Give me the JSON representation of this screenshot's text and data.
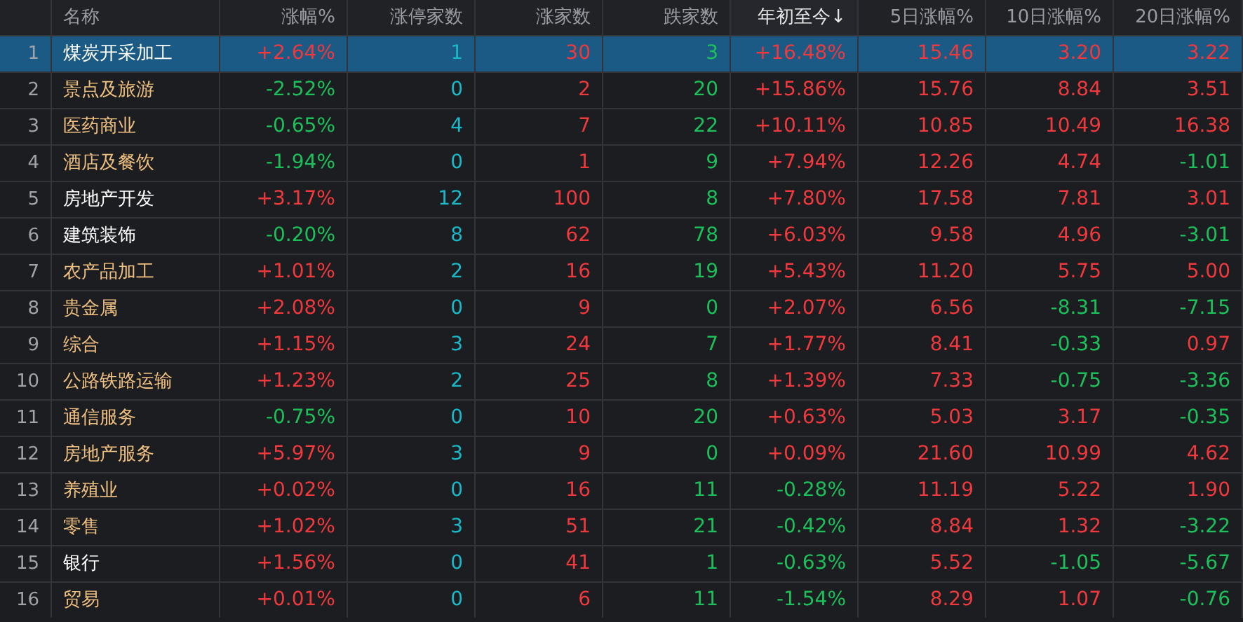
{
  "table": {
    "columns": [
      {
        "label": "名称",
        "sorted": false
      },
      {
        "label": "涨幅%",
        "sorted": false
      },
      {
        "label": "涨停家数",
        "sorted": false,
        "color": "#19b8c8"
      },
      {
        "label": "涨家数",
        "sorted": false,
        "color": "#f0393c"
      },
      {
        "label": "跌家数",
        "sorted": false,
        "color": "#1cc05a"
      },
      {
        "label": "年初至今↓",
        "sorted": true
      },
      {
        "label": "5日涨幅%",
        "sorted": false
      },
      {
        "label": "10日涨幅%",
        "sorted": false
      },
      {
        "label": "20日涨幅%",
        "sorted": false
      }
    ],
    "rows": [
      {
        "num": "1",
        "selected": true,
        "cells": [
          {
            "t": "煤炭开采加工",
            "color": "#ffffff"
          },
          {
            "t": "+2.64%",
            "up": true
          },
          {
            "t": "1"
          },
          {
            "t": "30"
          },
          {
            "t": "3"
          },
          {
            "t": "+16.48%",
            "up": true
          },
          {
            "t": "15.46",
            "up": true
          },
          {
            "t": "3.20",
            "up": true
          },
          {
            "t": "3.22",
            "up": true
          }
        ]
      },
      {
        "num": "2",
        "selected": false,
        "cells": [
          {
            "t": "景点及旅游",
            "color": "#f0c080"
          },
          {
            "t": "-2.52%",
            "up": false
          },
          {
            "t": "0"
          },
          {
            "t": "2"
          },
          {
            "t": "20"
          },
          {
            "t": "+15.86%",
            "up": true
          },
          {
            "t": "15.76",
            "up": true
          },
          {
            "t": "8.84",
            "up": true
          },
          {
            "t": "3.51",
            "up": true
          }
        ]
      },
      {
        "num": "3",
        "selected": false,
        "cells": [
          {
            "t": "医药商业",
            "color": "#f0c080"
          },
          {
            "t": "-0.65%",
            "up": false
          },
          {
            "t": "4"
          },
          {
            "t": "7"
          },
          {
            "t": "22"
          },
          {
            "t": "+10.11%",
            "up": true
          },
          {
            "t": "10.85",
            "up": true
          },
          {
            "t": "10.49",
            "up": true
          },
          {
            "t": "16.38",
            "up": true
          }
        ]
      },
      {
        "num": "4",
        "selected": false,
        "cells": [
          {
            "t": "酒店及餐饮",
            "color": "#f0c080"
          },
          {
            "t": "-1.94%",
            "up": false
          },
          {
            "t": "0"
          },
          {
            "t": "1"
          },
          {
            "t": "9"
          },
          {
            "t": "+7.94%",
            "up": true
          },
          {
            "t": "12.26",
            "up": true
          },
          {
            "t": "4.74",
            "up": true
          },
          {
            "t": "-1.01",
            "up": false
          }
        ]
      },
      {
        "num": "5",
        "selected": false,
        "cells": [
          {
            "t": "房地产开发",
            "color": "#ffffff"
          },
          {
            "t": "+3.17%",
            "up": true
          },
          {
            "t": "12"
          },
          {
            "t": "100"
          },
          {
            "t": "8"
          },
          {
            "t": "+7.80%",
            "up": true
          },
          {
            "t": "17.58",
            "up": true
          },
          {
            "t": "7.81",
            "up": true
          },
          {
            "t": "3.01",
            "up": true
          }
        ]
      },
      {
        "num": "6",
        "selected": false,
        "cells": [
          {
            "t": "建筑装饰",
            "color": "#ffffff"
          },
          {
            "t": "-0.20%",
            "up": false
          },
          {
            "t": "8"
          },
          {
            "t": "62"
          },
          {
            "t": "78"
          },
          {
            "t": "+6.03%",
            "up": true
          },
          {
            "t": "9.58",
            "up": true
          },
          {
            "t": "4.96",
            "up": true
          },
          {
            "t": "-3.01",
            "up": false
          }
        ]
      },
      {
        "num": "7",
        "selected": false,
        "cells": [
          {
            "t": "农产品加工",
            "color": "#f0c080"
          },
          {
            "t": "+1.01%",
            "up": true
          },
          {
            "t": "2"
          },
          {
            "t": "16"
          },
          {
            "t": "19"
          },
          {
            "t": "+5.43%",
            "up": true
          },
          {
            "t": "11.20",
            "up": true
          },
          {
            "t": "5.75",
            "up": true
          },
          {
            "t": "5.00",
            "up": true
          }
        ]
      },
      {
        "num": "8",
        "selected": false,
        "cells": [
          {
            "t": "贵金属",
            "color": "#f0c080"
          },
          {
            "t": "+2.08%",
            "up": true
          },
          {
            "t": "0"
          },
          {
            "t": "9"
          },
          {
            "t": "0"
          },
          {
            "t": "+2.07%",
            "up": true
          },
          {
            "t": "6.56",
            "up": true
          },
          {
            "t": "-8.31",
            "up": false
          },
          {
            "t": "-7.15",
            "up": false
          }
        ]
      },
      {
        "num": "9",
        "selected": false,
        "cells": [
          {
            "t": "综合",
            "color": "#f0c080"
          },
          {
            "t": "+1.15%",
            "up": true
          },
          {
            "t": "3"
          },
          {
            "t": "24"
          },
          {
            "t": "7"
          },
          {
            "t": "+1.77%",
            "up": true
          },
          {
            "t": "8.41",
            "up": true
          },
          {
            "t": "-0.33",
            "up": false
          },
          {
            "t": "0.97",
            "up": true
          }
        ]
      },
      {
        "num": "10",
        "selected": false,
        "cells": [
          {
            "t": "公路铁路运输",
            "color": "#f0c080"
          },
          {
            "t": "+1.23%",
            "up": true
          },
          {
            "t": "2"
          },
          {
            "t": "25"
          },
          {
            "t": "8"
          },
          {
            "t": "+1.39%",
            "up": true
          },
          {
            "t": "7.33",
            "up": true
          },
          {
            "t": "-0.75",
            "up": false
          },
          {
            "t": "-3.36",
            "up": false
          }
        ]
      },
      {
        "num": "11",
        "selected": false,
        "cells": [
          {
            "t": "通信服务",
            "color": "#f0c080"
          },
          {
            "t": "-0.75%",
            "up": false
          },
          {
            "t": "0"
          },
          {
            "t": "10"
          },
          {
            "t": "20"
          },
          {
            "t": "+0.63%",
            "up": true
          },
          {
            "t": "5.03",
            "up": true
          },
          {
            "t": "3.17",
            "up": true
          },
          {
            "t": "-0.35",
            "up": false
          }
        ]
      },
      {
        "num": "12",
        "selected": false,
        "cells": [
          {
            "t": "房地产服务",
            "color": "#f0c080"
          },
          {
            "t": "+5.97%",
            "up": true
          },
          {
            "t": "3"
          },
          {
            "t": "9"
          },
          {
            "t": "0"
          },
          {
            "t": "+0.09%",
            "up": true
          },
          {
            "t": "21.60",
            "up": true
          },
          {
            "t": "10.99",
            "up": true
          },
          {
            "t": "4.62",
            "up": true
          }
        ]
      },
      {
        "num": "13",
        "selected": false,
        "cells": [
          {
            "t": "养殖业",
            "color": "#f0c080"
          },
          {
            "t": "+0.02%",
            "up": true
          },
          {
            "t": "0"
          },
          {
            "t": "16"
          },
          {
            "t": "11"
          },
          {
            "t": "-0.28%",
            "up": false
          },
          {
            "t": "11.19",
            "up": true
          },
          {
            "t": "5.22",
            "up": true
          },
          {
            "t": "1.90",
            "up": true
          }
        ]
      },
      {
        "num": "14",
        "selected": false,
        "cells": [
          {
            "t": "零售",
            "color": "#f0c080"
          },
          {
            "t": "+1.02%",
            "up": true
          },
          {
            "t": "3"
          },
          {
            "t": "51"
          },
          {
            "t": "21"
          },
          {
            "t": "-0.42%",
            "up": false
          },
          {
            "t": "8.84",
            "up": true
          },
          {
            "t": "1.32",
            "up": true
          },
          {
            "t": "-3.22",
            "up": false
          }
        ]
      },
      {
        "num": "15",
        "selected": false,
        "cells": [
          {
            "t": "银行",
            "color": "#ffffff"
          },
          {
            "t": "+1.56%",
            "up": true
          },
          {
            "t": "0"
          },
          {
            "t": "41"
          },
          {
            "t": "1"
          },
          {
            "t": "-0.63%",
            "up": false
          },
          {
            "t": "5.52",
            "up": true
          },
          {
            "t": "-1.05",
            "up": false
          },
          {
            "t": "-5.67",
            "up": false
          }
        ]
      },
      {
        "num": "16",
        "selected": false,
        "cells": [
          {
            "t": "贸易",
            "color": "#f0c080"
          },
          {
            "t": "+0.01%",
            "up": true
          },
          {
            "t": "0"
          },
          {
            "t": "6"
          },
          {
            "t": "11"
          },
          {
            "t": "-1.54%",
            "up": false
          },
          {
            "t": "8.29",
            "up": true
          },
          {
            "t": "1.07",
            "up": true
          },
          {
            "t": "-0.76",
            "up": false
          }
        ]
      }
    ]
  }
}
